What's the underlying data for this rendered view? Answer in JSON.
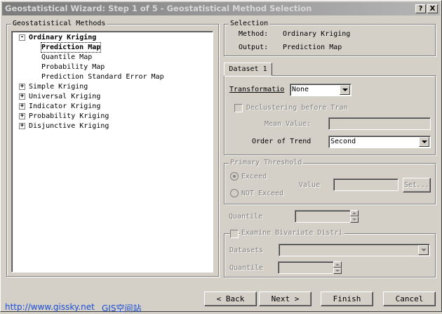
{
  "window": {
    "title": "Geostatistical Wizard: Step 1 of 5 - Geostatistical Method Selection",
    "help_label": "?",
    "close_label": "X"
  },
  "methods": {
    "group_title": "Geostatistical Methods",
    "tree": [
      {
        "label": "Ordinary Kriging",
        "expander": "-"
      },
      {
        "label": "Prediction Map"
      },
      {
        "label": "Quantile Map"
      },
      {
        "label": "Probability Map"
      },
      {
        "label": "Prediction Standard Error Map"
      },
      {
        "label": "Simple Kriging",
        "expander": "+"
      },
      {
        "label": "Universal Kriging",
        "expander": "+"
      },
      {
        "label": "Indicator Kriging",
        "expander": "+"
      },
      {
        "label": "Probability Kriging",
        "expander": "+"
      },
      {
        "label": "Disjunctive Kriging",
        "expander": "+"
      }
    ]
  },
  "selection": {
    "group_title": "Selection",
    "method_label": "Method:",
    "method_value": "Ordinary Kriging",
    "output_label": "Output:",
    "output_value": "Prediction Map"
  },
  "dataset": {
    "tab_label": "Dataset 1",
    "transformation_label": "Transformatio",
    "transformation_value": "None",
    "declustering_label": "Declustering before Tran",
    "mean_value_label": "Mean Value:",
    "mean_value": "",
    "order_label": "Order of Trend",
    "order_value": "Second"
  },
  "threshold": {
    "group_title": "Primary Threshold",
    "exceed_label": "Exceed",
    "not_exceed_label": "NOT Exceed",
    "value_label": "Value",
    "value": "",
    "set_label": "Set..."
  },
  "quantile": {
    "label": "Quantile",
    "value": ""
  },
  "bivariate": {
    "group_title": "Examine Bivariate Distri",
    "datasets_label": "Datasets",
    "datasets_value": "",
    "quantile_label": "Quantile",
    "quantile_value": ""
  },
  "buttons": {
    "back": "< Back",
    "next": "Next >",
    "finish": "Finish",
    "cancel": "Cancel"
  },
  "watermark": {
    "url": "http://www.gissky.net",
    "name": "GIS空间站"
  }
}
